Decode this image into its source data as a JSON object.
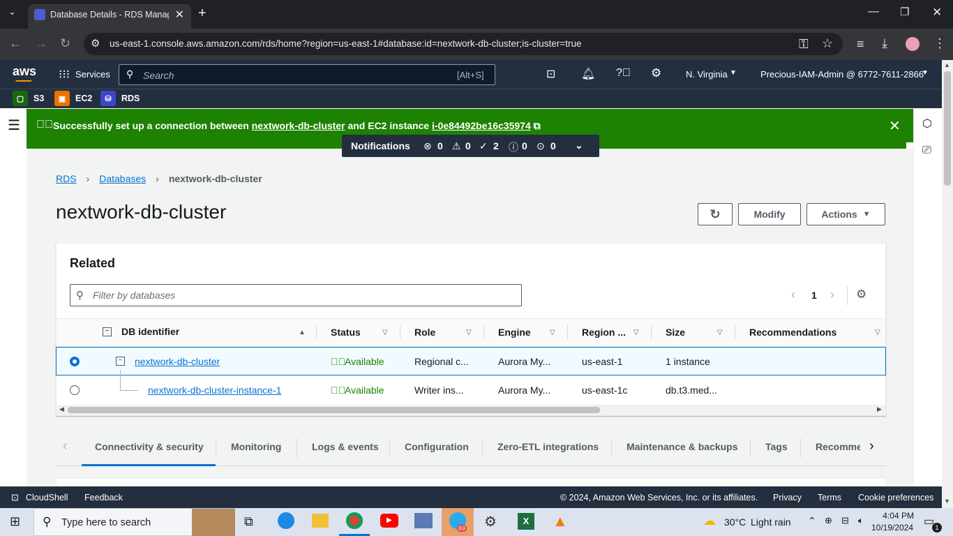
{
  "browser": {
    "tab_title": "Database Details - RDS Manage",
    "url": "us-east-1.console.aws.amazon.com/rds/home?region=us-east-1#database:id=nextwork-db-cluster;is-cluster=true"
  },
  "aws": {
    "logo": "aws",
    "services_label": "Services",
    "search_placeholder": "Search",
    "search_shortcut": "[Alt+S]",
    "region": "N. Virginia",
    "account": "Precious-IAM-Admin @ 6772-7611-2866"
  },
  "favorites": [
    {
      "label": "S3",
      "color": "#1b660f"
    },
    {
      "label": "EC2",
      "color": "#ed7100"
    },
    {
      "label": "RDS",
      "color": "#3b48cc"
    }
  ],
  "banner": {
    "pre": "Successfully set up a connection between ",
    "db": "nextwork-db-cluster",
    "mid": " and EC2 instance ",
    "instance": "i-0e84492be16c35974"
  },
  "notifications": {
    "label": "Notifications",
    "error": "0",
    "warning": "0",
    "success": "2",
    "info": "0",
    "pending": "0"
  },
  "breadcrumb": {
    "rds": "RDS",
    "databases": "Databases",
    "current": "nextwork-db-cluster"
  },
  "page_title": "nextwork-db-cluster",
  "actions": {
    "modify": "Modify",
    "actions": "Actions"
  },
  "related": {
    "title": "Related",
    "filter_placeholder": "Filter by databases",
    "page": "1",
    "columns": [
      "DB identifier",
      "Status",
      "Role",
      "Engine",
      "Region ...",
      "Size",
      "Recommendations"
    ],
    "rows": [
      {
        "id": "nextwork-db-cluster",
        "status": "Available",
        "role": "Regional c...",
        "engine": "Aurora My...",
        "region": "us-east-1",
        "size": "1 instance",
        "selected": true
      },
      {
        "id": "nextwork-db-cluster-instance-1",
        "status": "Available",
        "role": "Writer ins...",
        "engine": "Aurora My...",
        "region": "us-east-1c",
        "size": "db.t3.med...",
        "selected": false
      }
    ]
  },
  "tabs": [
    "Connectivity & security",
    "Monitoring",
    "Logs & events",
    "Configuration",
    "Zero-ETL integrations",
    "Maintenance & backups",
    "Tags",
    "Recomme"
  ],
  "footer": {
    "cloudshell": "CloudShell",
    "feedback": "Feedback",
    "copyright": "© 2024, Amazon Web Services, Inc. or its affiliates.",
    "privacy": "Privacy",
    "terms": "Terms",
    "cookies": "Cookie preferences"
  },
  "taskbar": {
    "search": "Type here to search",
    "weather_temp": "30°C",
    "weather": "Light rain",
    "time": "4:04 PM",
    "date": "10/19/2024",
    "telegram_badge": "69",
    "notif_count": "1"
  }
}
